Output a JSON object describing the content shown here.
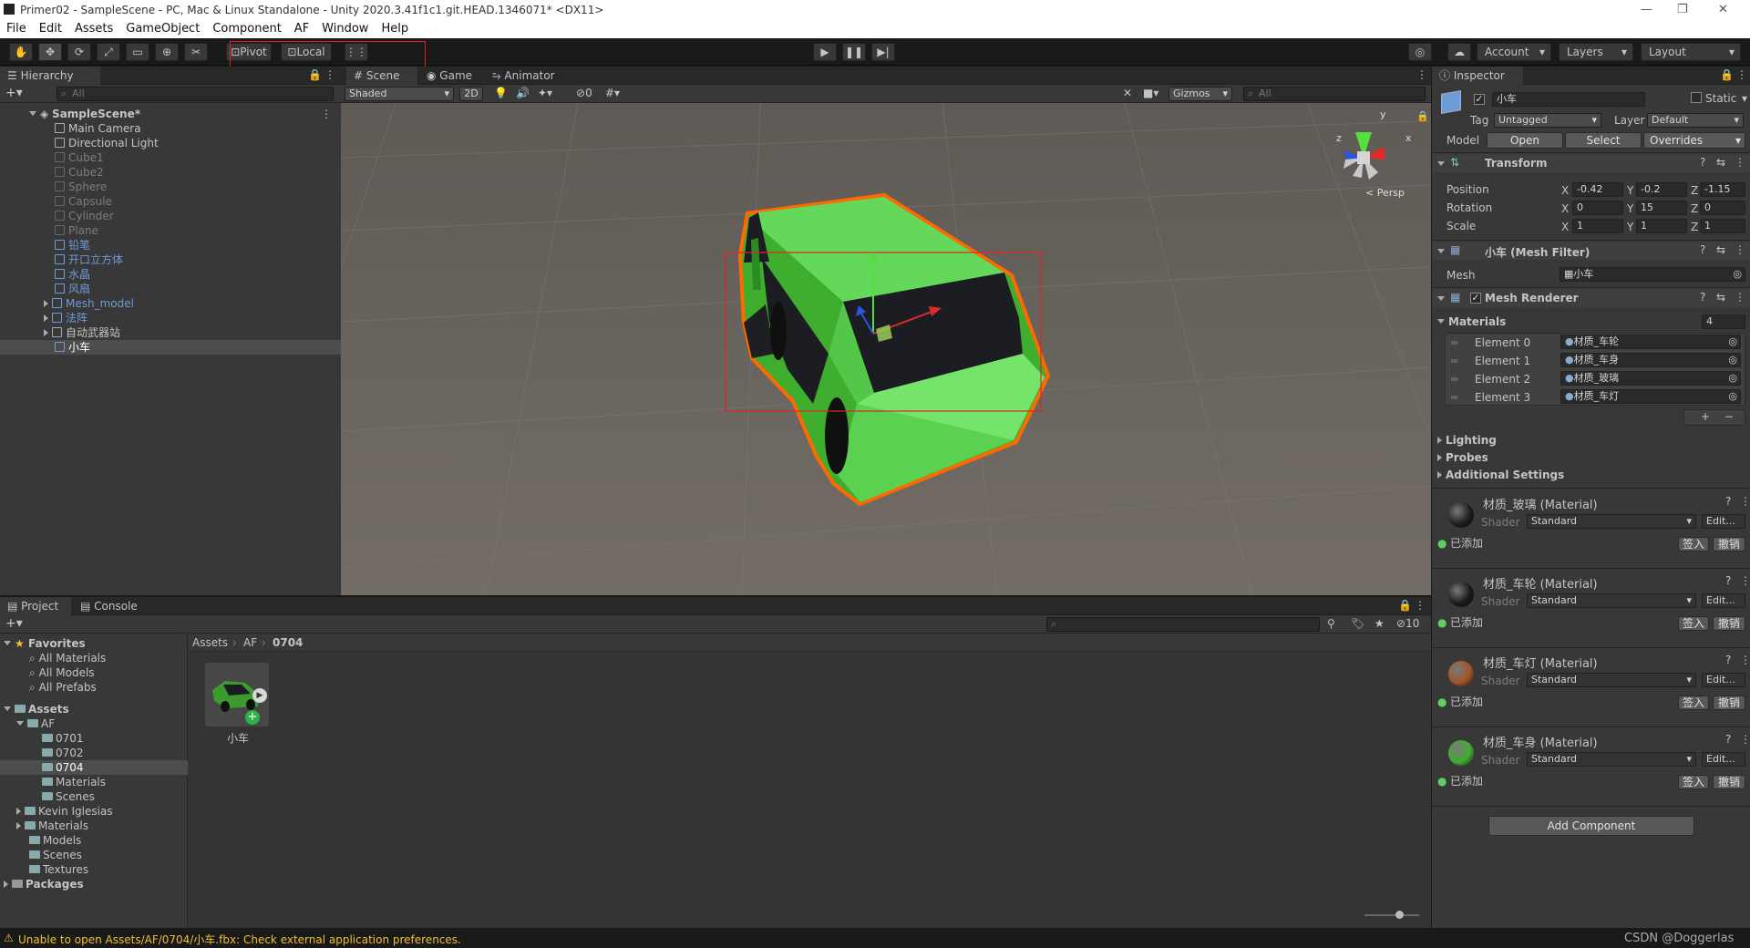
{
  "window": {
    "title": "Primer02 - SampleScene - PC, Mac & Linux Standalone - Unity 2020.3.41f1c1.git.HEAD.1346071* <DX11>"
  },
  "menu": [
    "File",
    "Edit",
    "Assets",
    "GameObject",
    "Component",
    "AF",
    "Window",
    "Help"
  ],
  "toolbar": {
    "pivot": "Pivot",
    "local": "Local",
    "account": "Account",
    "layers": "Layers",
    "layout": "Layout"
  },
  "hierarchy": {
    "tab": "Hierarchy",
    "search": "All",
    "scene": "SampleScene*",
    "items": [
      "Main Camera",
      "Directional Light",
      "Cube1",
      "Cube2",
      "Sphere",
      "Capsule",
      "Cylinder",
      "Plane",
      "铅笔",
      "开口立方体",
      "水晶",
      "风扇",
      "Mesh_model",
      "法阵",
      "自动武器站",
      "小车"
    ]
  },
  "scene": {
    "tabs": [
      "Scene",
      "Game",
      "Animator"
    ],
    "shading": "Shaded",
    "mode2d": "2D",
    "hidden_count": "0",
    "gizmos": "Gizmos",
    "search": "All",
    "persp": "< Persp",
    "axis_x": "x",
    "axis_y": "y",
    "axis_z": "z"
  },
  "inspector": {
    "tab": "Inspector",
    "name": "小车",
    "static": "Static",
    "tag_label": "Tag",
    "tag": "Untagged",
    "layer_label": "Layer",
    "layer": "Default",
    "model_label": "Model",
    "open": "Open",
    "select": "Select",
    "overrides": "Overrides",
    "transform": {
      "title": "Transform",
      "position": "Position",
      "rotation": "Rotation",
      "scale": "Scale",
      "pos": [
        "-0.42",
        "-0.2",
        "-1.15"
      ],
      "rot": [
        "0",
        "15",
        "0"
      ],
      "scl": [
        "1",
        "1",
        "1"
      ]
    },
    "mesh_filter": {
      "title": "小车 (Mesh Filter)",
      "mesh_label": "Mesh",
      "mesh": "小车"
    },
    "mesh_renderer": {
      "title": "Mesh Renderer",
      "materials": "Materials",
      "count": "4",
      "elements": [
        {
          "label": "Element 0",
          "value": "材质_车轮"
        },
        {
          "label": "Element 1",
          "value": "材质_车身"
        },
        {
          "label": "Element 2",
          "value": "材质_玻璃"
        },
        {
          "label": "Element 3",
          "value": "材质_车灯"
        }
      ],
      "lighting": "Lighting",
      "probes": "Probes",
      "additional": "Additional Settings"
    },
    "materials": [
      {
        "name": "材质_玻璃 (Material)",
        "color": "#1e1e1e"
      },
      {
        "name": "材质_车轮 (Material)",
        "color": "#1a1a1a"
      },
      {
        "name": "材质_车灯 (Material)",
        "color": "#a3542a"
      },
      {
        "name": "材质_车身 (Material)",
        "color": "#3fae2f"
      }
    ],
    "shader_label": "Shader",
    "shader": "Standard",
    "edit": "Edit...",
    "added": "已添加",
    "sign": "签入",
    "undo": "撤销",
    "add_component": "Add Component"
  },
  "project": {
    "tabs": [
      "Project",
      "Console"
    ],
    "breadcrumb": [
      "Assets",
      "AF",
      "0704"
    ],
    "hidden_count": "10",
    "favorites": "Favorites",
    "fav_items": [
      "All Materials",
      "All Models",
      "All Prefabs"
    ],
    "assets": "Assets",
    "af": "AF",
    "af_items": [
      "0701",
      "0702",
      "0704",
      "Materials",
      "Scenes"
    ],
    "other_items": [
      "Kevin Iglesias",
      "Materials",
      "Models",
      "Scenes",
      "Textures"
    ],
    "packages": "Packages",
    "asset_name": "小车"
  },
  "status": {
    "message": "Unable to open Assets/AF/0704/小车.fbx: Check external application preferences.",
    "watermark": "CSDN @Doggerlas"
  }
}
